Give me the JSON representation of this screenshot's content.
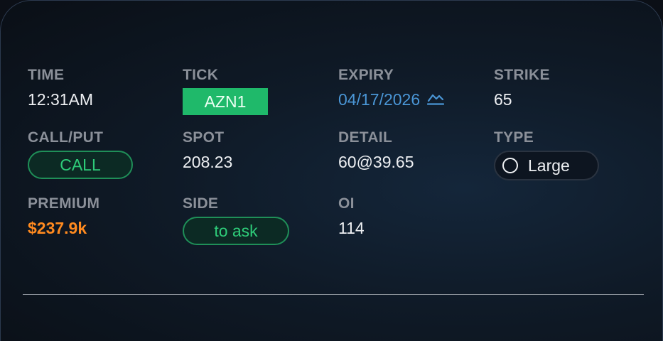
{
  "time": {
    "label": "TIME",
    "value": "12:31AM"
  },
  "tick": {
    "label": "TICK",
    "value": "AZN1"
  },
  "expiry": {
    "label": "EXPIRY",
    "value": "04/17/2026",
    "icon": "chart-line-icon"
  },
  "strike": {
    "label": "STRIKE",
    "value": "65"
  },
  "call_put": {
    "label": "CALL/PUT",
    "value": "CALL"
  },
  "spot": {
    "label": "SPOT",
    "value": "208.23"
  },
  "detail": {
    "label": "DETAIL",
    "value": "60@39.65"
  },
  "type": {
    "label": "TYPE",
    "value": "Large",
    "icon": "circle-icon"
  },
  "premium": {
    "label": "PREMIUM",
    "value": "$237.9k"
  },
  "side": {
    "label": "SIDE",
    "value": "to ask"
  },
  "oi": {
    "label": "OI",
    "value": "114"
  },
  "colors": {
    "accent_green": "#1fb96a",
    "premium_orange": "#ff8a1f",
    "link_blue": "#4a96d6",
    "label_gray": "#8b9099"
  }
}
